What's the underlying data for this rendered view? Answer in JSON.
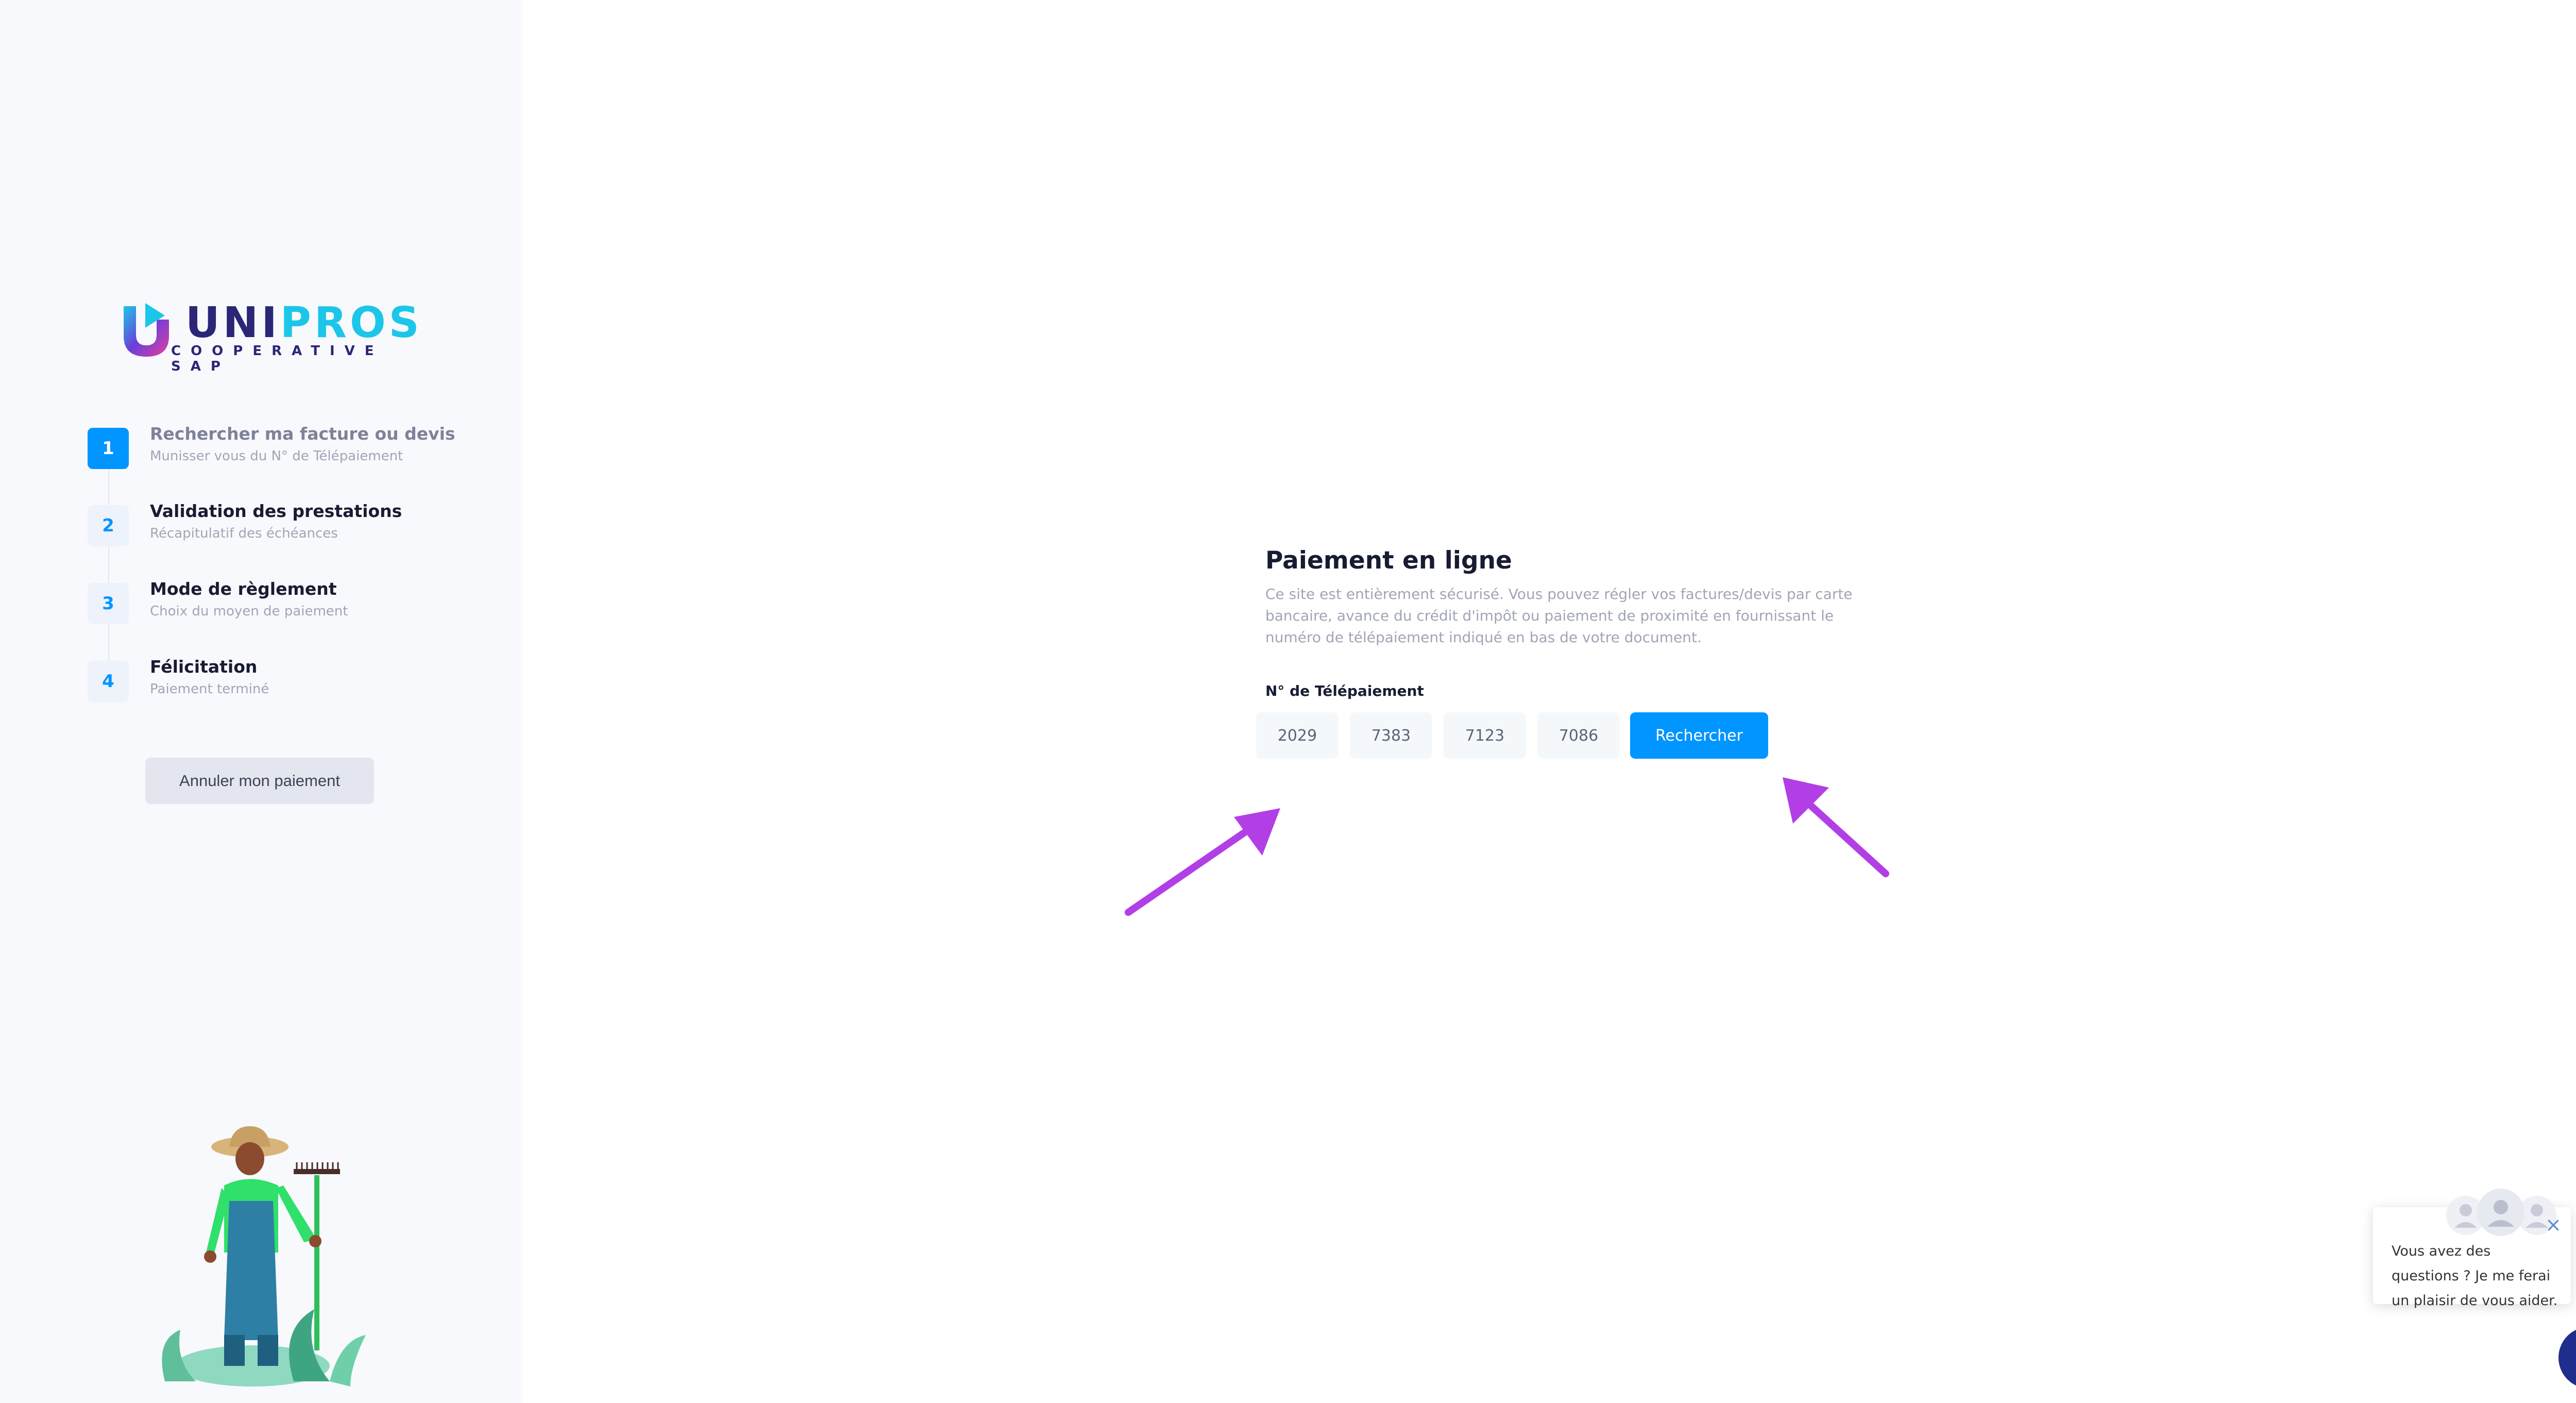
{
  "brand": {
    "name_part1": "UNI",
    "name_part2": "PROS",
    "subtitle": "COOPERATIVE SAP"
  },
  "steps": [
    {
      "number": "1",
      "title": "Rechercher ma facture ou devis",
      "subtitle": "Munisser vous du N° de Télépaiement",
      "active": true
    },
    {
      "number": "2",
      "title": "Validation des prestations",
      "subtitle": "Récapitulatif des échéances",
      "active": false
    },
    {
      "number": "3",
      "title": "Mode de règlement",
      "subtitle": "Choix du moyen de paiement",
      "active": false
    },
    {
      "number": "4",
      "title": "Félicitation",
      "subtitle": "Paiement terminé",
      "active": false
    }
  ],
  "cancel_button": "Annuler mon paiement",
  "payment": {
    "title": "Paiement en ligne",
    "description": "Ce site est entièrement sécurisé. Vous pouvez régler vos factures/devis par carte bancaire, avance du crédit d'impôt ou paiement de proximité en fournissant le numéro de télépaiement indiqué en bas de votre document.",
    "field_label": "N° de Télépaiement",
    "codes": [
      "2029",
      "7383",
      "7123",
      "7086"
    ],
    "search_button": "Rechercher"
  },
  "chat": {
    "message": "Vous avez des questions ? Je me ferai un plaisir de vous aider.",
    "close_icon": "close-icon",
    "launcher_icon": "chat-bubble-icon"
  },
  "colors": {
    "accent": "#0095ff",
    "arrow": "#b23fe6",
    "chat_launcher": "#1f2d8c"
  }
}
